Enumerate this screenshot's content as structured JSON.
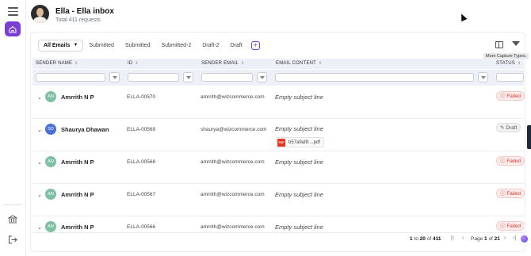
{
  "header": {
    "title": "Ella - Ella inbox",
    "subtitle": "Total 411 requests"
  },
  "tabs": [
    {
      "label": "All Emails",
      "active": true
    },
    {
      "label": "Submitted"
    },
    {
      "label": "Submitted"
    },
    {
      "label": "Submitted-2"
    },
    {
      "label": "Draft-2"
    },
    {
      "label": "Draft"
    }
  ],
  "add_tab": "+",
  "tooltip": "More Capture Types.",
  "columns": {
    "sender_name": "SENDER NAME",
    "id": "ID",
    "sender_email": "SENDER EMAIL",
    "email_content": "EMAIL CONTENT",
    "status": "STATUS"
  },
  "rows": [
    {
      "initials": "AN",
      "avatar_color": "#7fbfa4",
      "name": "Amrrith N P",
      "id": "ELLA-00570",
      "email": "amrrith@wizcommerce.com",
      "content": "Empty subject line",
      "status": "Failed",
      "status_type": "failed"
    },
    {
      "initials": "SD",
      "avatar_color": "#4a6fd6",
      "name": "Shaurya Dhawan",
      "id": "ELLA-00569",
      "email": "shaurya@wizcommerce.com",
      "content": "Empty subject line",
      "attachment": "b57a9af8....pdf",
      "attachment_icon": "PDF",
      "status": "Draft",
      "status_type": "draft"
    },
    {
      "initials": "AN",
      "avatar_color": "#7fbfa4",
      "name": "Amrrith N P",
      "id": "ELLA-00568",
      "email": "amrrith@wizcommerce.com",
      "content": "Empty subject line",
      "status": "Failed",
      "status_type": "failed"
    },
    {
      "initials": "AN",
      "avatar_color": "#7fbfa4",
      "name": "Amrrith N P",
      "id": "ELLA-00567",
      "email": "amrrith@wizcommerce.com",
      "content": "Empty subject line",
      "status": "Failed",
      "status_type": "failed"
    },
    {
      "initials": "AN",
      "avatar_color": "#7fbfa4",
      "name": "Amrrith N P",
      "id": "ELLA-00566",
      "email": "amrrith@wizcommerce.com",
      "content": "Empty subject line",
      "status": "Failed",
      "status_type": "failed"
    }
  ],
  "pagination": {
    "range_start": "1",
    "to": "to",
    "range_end": "20",
    "of": "of",
    "total": "411",
    "page_label": "Page",
    "page": "1",
    "page_of": "of",
    "pages": "21"
  },
  "colors": {
    "accent": "#7b3fd4",
    "failed": "#d9362b",
    "header_bg": "#eef0f7"
  },
  "icons": [
    "menu-icon",
    "home-icon",
    "bank-icon",
    "logout-icon",
    "columns-icon",
    "filter-icon",
    "sort-icon",
    "chevron-down-icon",
    "first-page-icon",
    "prev-page-icon",
    "next-page-icon",
    "last-page-icon",
    "pencil-icon",
    "alert-icon"
  ]
}
